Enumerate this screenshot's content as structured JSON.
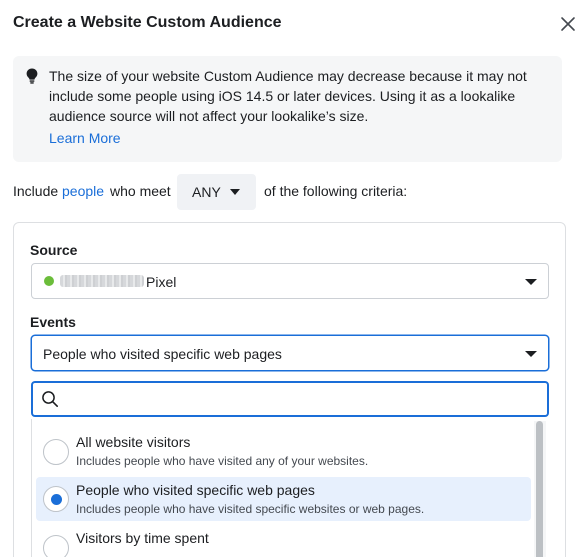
{
  "dialog": {
    "title": "Create a Website Custom Audience",
    "close_icon": "close-icon"
  },
  "banner": {
    "icon": "lightbulb-icon",
    "text": "The size of your website Custom Audience may decrease because it may not include some people using iOS 14.5 or later devices. Using it as a lookalike audience source will not affect your lookalike’s size.",
    "learn_more": "Learn More"
  },
  "criteria": {
    "prefix": "Include",
    "people_link": "people",
    "middle": "who meet",
    "match_value": "ANY",
    "suffix": "of the following criteria:"
  },
  "source": {
    "label": "Source",
    "status_color": "#6bbd3a",
    "value": "Pixel"
  },
  "events": {
    "label": "Events",
    "selected": "People who visited specific web pages",
    "search_placeholder": "",
    "options": [
      {
        "title": "All website visitors",
        "description": "Includes people who have visited any of your websites.",
        "selected": false
      },
      {
        "title": "People who visited specific web pages",
        "description": "Includes people who have visited specific websites or web pages.",
        "selected": true
      },
      {
        "title": "Visitors by time spent",
        "description": "",
        "selected": false
      }
    ]
  },
  "colors": {
    "accent": "#1a6ed8",
    "selected_bg": "#e7f0fd",
    "banner_bg": "#f5f6f7"
  }
}
